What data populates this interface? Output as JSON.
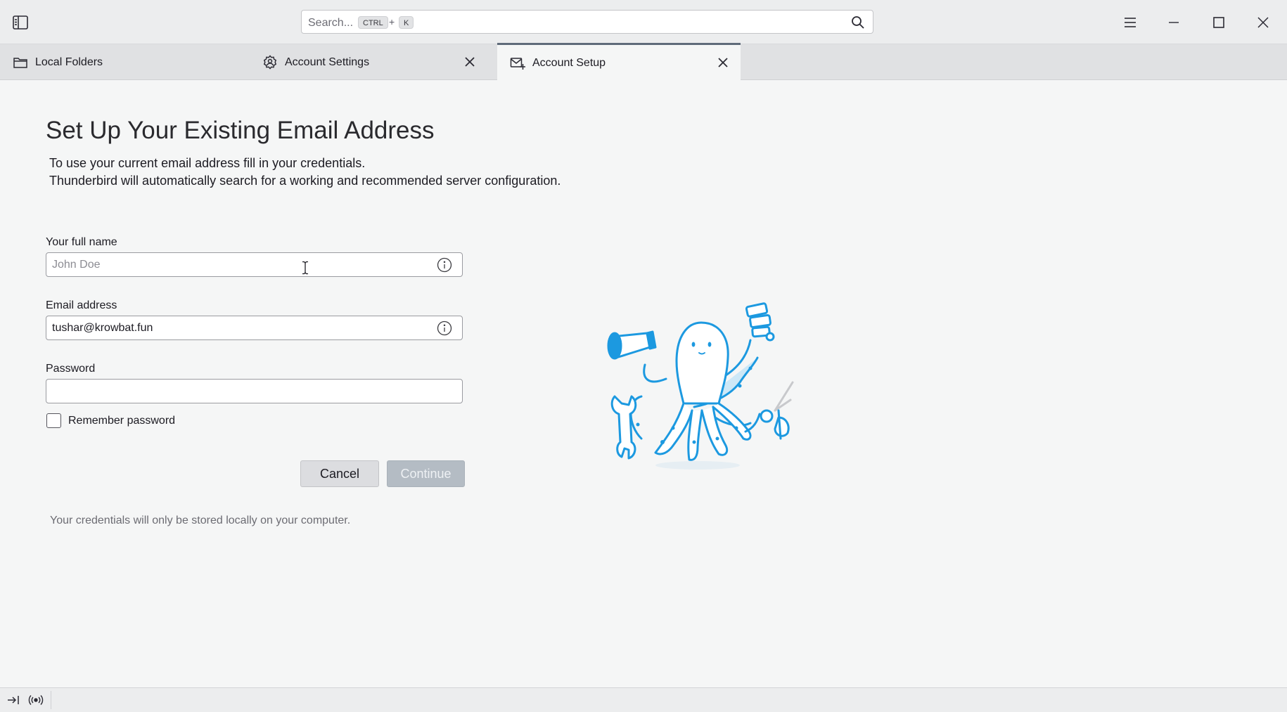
{
  "window": {
    "search_placeholder": "Search...",
    "shortcut_key1": "CTRL",
    "shortcut_plus": "+",
    "shortcut_key2": "K"
  },
  "tabs": [
    {
      "label": "Local Folders",
      "icon": "folder-icon",
      "closable": false
    },
    {
      "label": "Account Settings",
      "icon": "account-settings-icon",
      "closable": true
    },
    {
      "label": "Account Setup",
      "icon": "account-setup-icon",
      "closable": true,
      "active": true
    }
  ],
  "main": {
    "title": "Set Up Your Existing Email Address",
    "description_line1": "To use your current email address fill in your credentials.",
    "description_line2": "Thunderbird will automatically search for a working and recommended server configuration.",
    "full_name": {
      "label": "Your full name",
      "value": "",
      "placeholder": "John Doe"
    },
    "email": {
      "label": "Email address",
      "value": "tushar@krowbat.fun",
      "placeholder": ""
    },
    "password": {
      "label": "Password",
      "value": "",
      "placeholder": ""
    },
    "remember_password": {
      "label": "Remember password",
      "checked": false
    },
    "cancel_label": "Cancel",
    "continue_label": "Continue",
    "note": "Your credentials will only be stored locally on your computer."
  },
  "colors": {
    "accent": "#1c99e0",
    "background": "#f5f6f6",
    "titlebar": "#ecedee",
    "tabstrip": "#e0e1e3",
    "continue_disabled": "#b4bcc4"
  }
}
